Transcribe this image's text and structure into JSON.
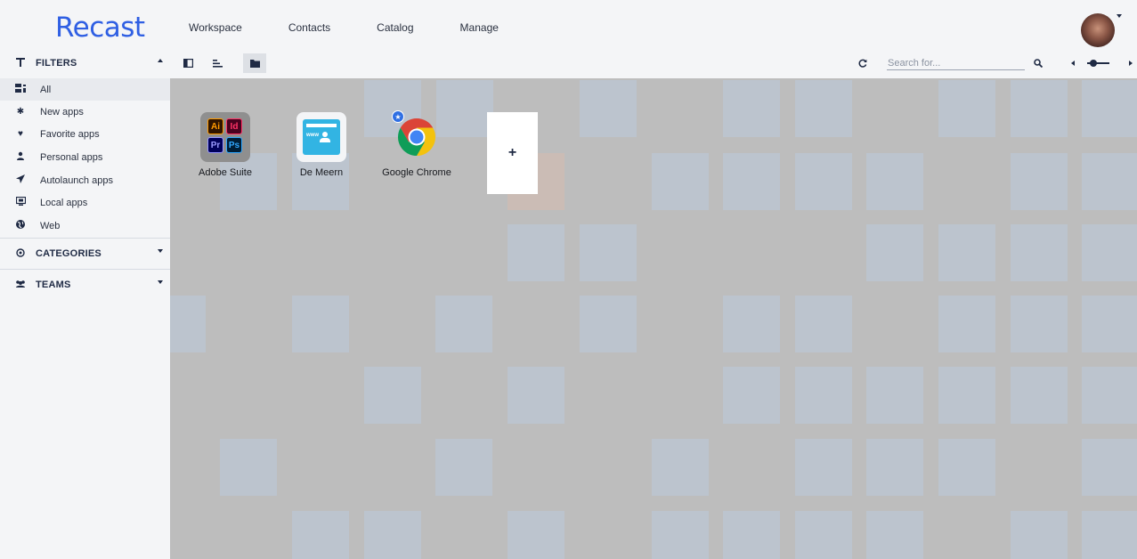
{
  "app": {
    "name": "Recast",
    "accent": "#2f5fe3"
  },
  "nav": {
    "items": [
      "Workspace",
      "Contacts",
      "Catalog",
      "Manage"
    ]
  },
  "user": {
    "avatar": "profile-photo"
  },
  "sidebar": {
    "filters": {
      "title": "FILTERS",
      "items": [
        {
          "label": "All",
          "icon": "grid-list-icon",
          "active": true
        },
        {
          "label": "New apps",
          "icon": "starburst-icon"
        },
        {
          "label": "Favorite apps",
          "icon": "heart-icon"
        },
        {
          "label": "Personal apps",
          "icon": "user-icon"
        },
        {
          "label": "Autolaunch apps",
          "icon": "send-icon"
        },
        {
          "label": "Local apps",
          "icon": "monitor-icon"
        },
        {
          "label": "Web",
          "icon": "globe-icon"
        }
      ]
    },
    "categories": {
      "title": "CATEGORIES"
    },
    "teams": {
      "title": "TEAMS"
    }
  },
  "toolbar": {
    "search_placeholder": "Search for..."
  },
  "workspace": {
    "background": "#bdbdbd",
    "apps": [
      {
        "label": "Adobe Suite",
        "icon": "adobe-suite-icon",
        "cells": [
          "Ai",
          "Id",
          "Pr",
          "Ps"
        ]
      },
      {
        "label": "De Meern",
        "icon": "web-contact-icon",
        "badge_text": "www"
      },
      {
        "label": "Google Chrome",
        "icon": "chrome-icon",
        "badge": "star-badge-icon"
      }
    ],
    "add_label": "+"
  }
}
